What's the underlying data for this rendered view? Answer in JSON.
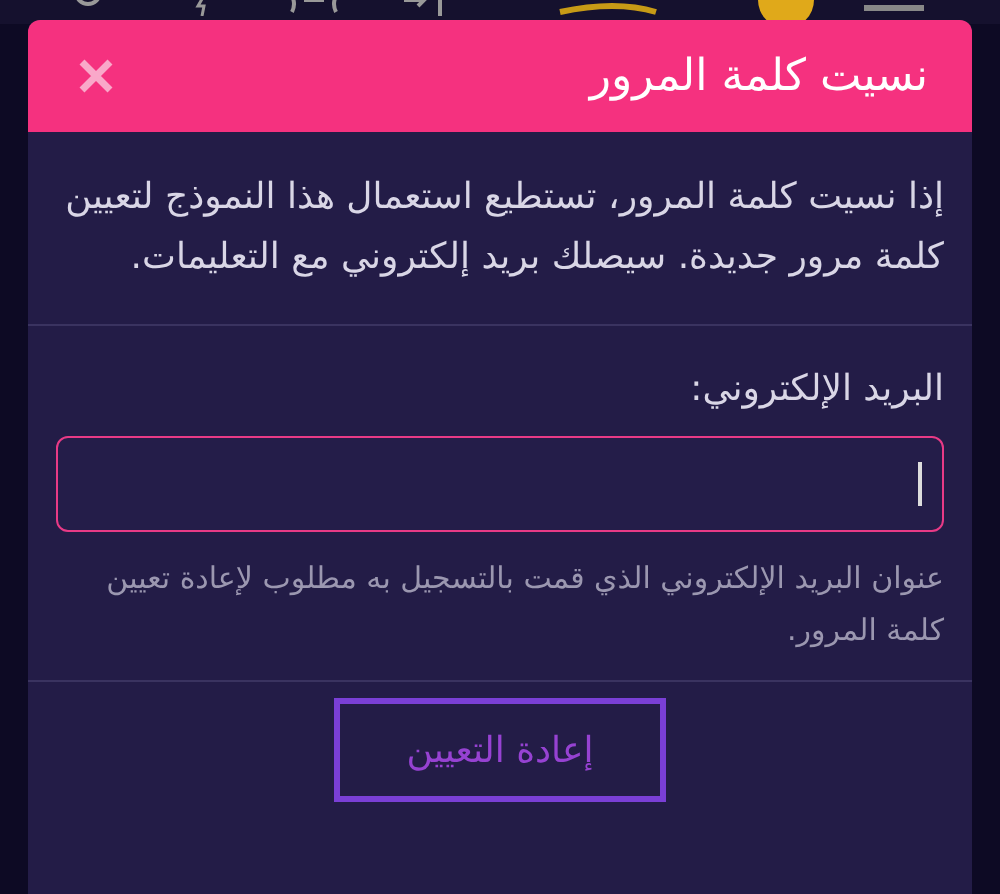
{
  "dialog": {
    "title": "نسيت كلمة المرور",
    "intro": "إذا نسيت كلمة المرور، تستطيع استعمال هذا النموذج لتعيين كلمة مرور جديدة. سيصلك بريد إلكتروني مع التعليمات.",
    "email_label": "البريد الإلكتروني:",
    "email_hint": "عنوان البريد الإلكتروني الذي قمت بالتسجيل به مطلوب لإعادة تعيين كلمة المرور.",
    "submit": "إعادة التعيين"
  }
}
